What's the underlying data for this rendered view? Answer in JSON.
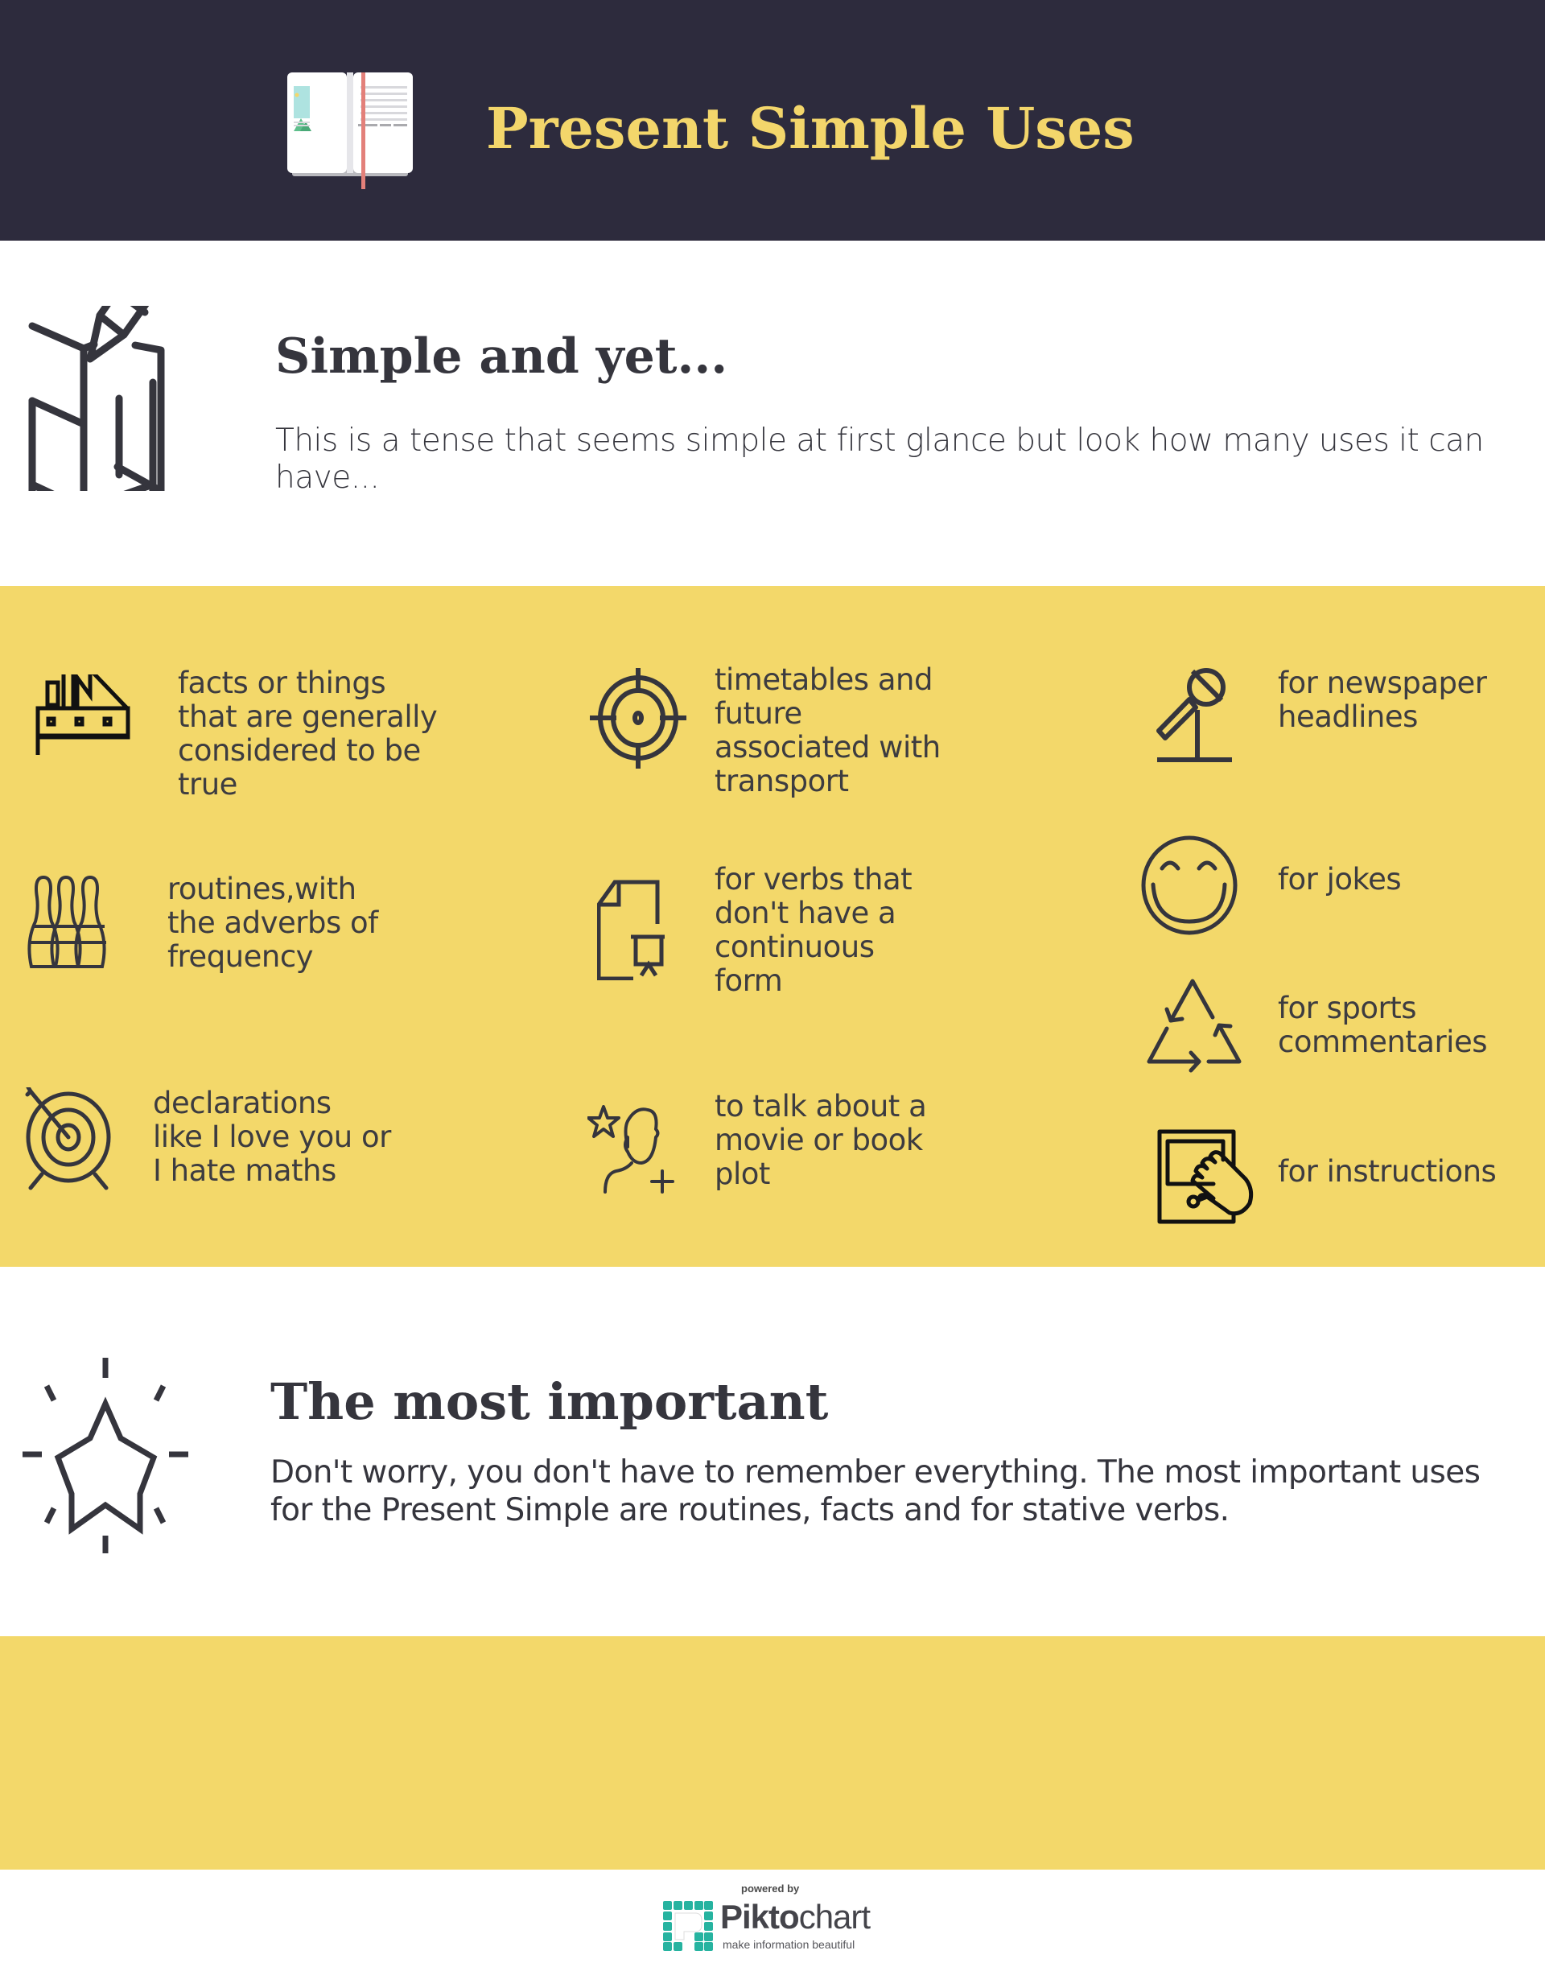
{
  "colors": {
    "header_bg": "#2d2b3d",
    "accent_yellow": "#f3d86a",
    "title_yellow": "#f3d66b",
    "text_dark": "#35353d",
    "piktochart_teal": "#26b3a0"
  },
  "header": {
    "title": "Present Simple Uses",
    "icon": "open-book-icon"
  },
  "intro": {
    "icon": "map-pencil-icon",
    "title": "Simple and yet...",
    "text": "This is a tense that seems simple at first glance but look how many uses it can have..."
  },
  "uses": [
    {
      "icon": "factory-icon",
      "text": "facts or things\nthat are generally\nconsidered to be\ntrue"
    },
    {
      "icon": "crosshair-icon",
      "text": "timetables and\nfuture\nassociated with\ntransport"
    },
    {
      "icon": "microphone-icon",
      "text": "for newspaper\nheadlines"
    },
    {
      "icon": "bowling-pins-icon",
      "text": "routines,with\nthe adverbs of\nfrequency"
    },
    {
      "icon": "document-presentation-icon",
      "text": "for verbs that\ndon't have a\ncontinuous\nform"
    },
    {
      "icon": "smiley-face-icon",
      "text": "for jokes"
    },
    {
      "icon": "recycle-icon",
      "text": "for sports\ncommentaries"
    },
    {
      "icon": "archery-target-icon",
      "text": "declarations\nlike I love you or\nI hate maths"
    },
    {
      "icon": "user-star-add-icon",
      "text": "to talk about a\nmovie or book\nplot"
    },
    {
      "icon": "tablet-touch-icon",
      "text": "for instructions"
    }
  ],
  "important": {
    "icon": "shining-star-icon",
    "title": "The most important",
    "text": "Don't worry, you don't have to remember everything. The most important uses for the Present Simple are routines, facts and for stative verbs."
  },
  "footer": {
    "powered_by": "powered by",
    "brand_bold": "Pikto",
    "brand_light": "chart",
    "tagline": "make information beautiful"
  }
}
